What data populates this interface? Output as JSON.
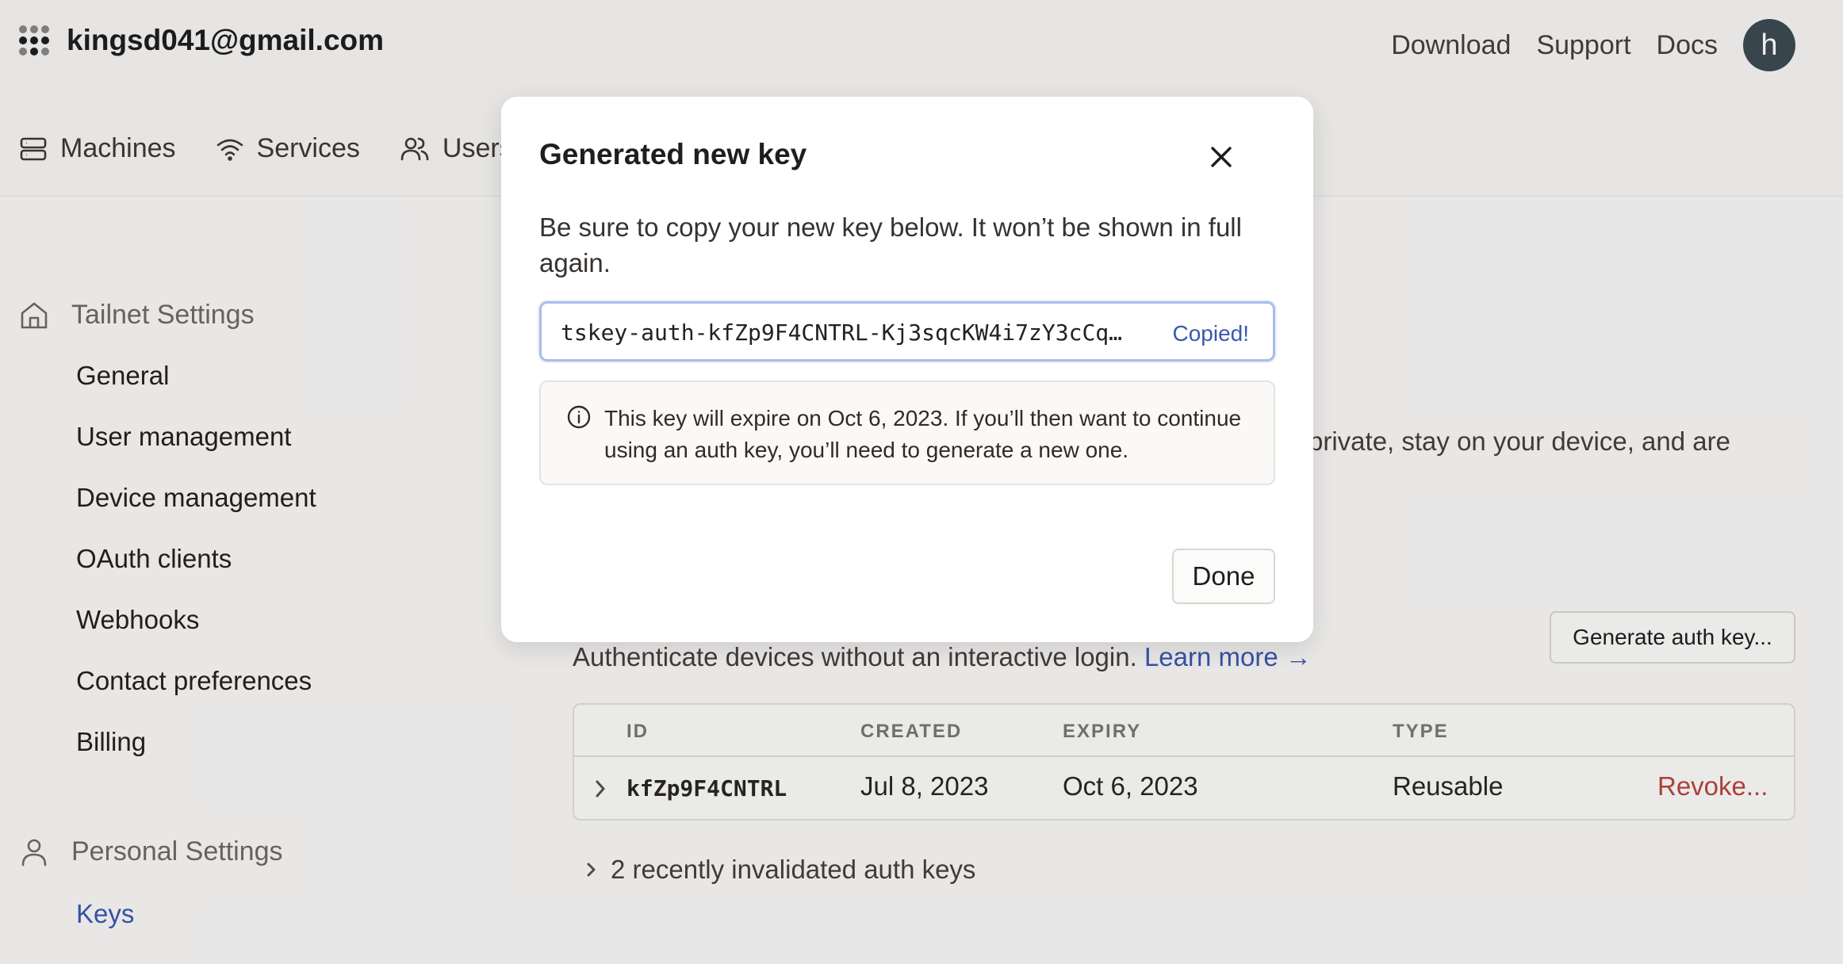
{
  "header": {
    "account": "kingsd041@gmail.com",
    "links": [
      "Download",
      "Support",
      "Docs"
    ],
    "avatar_initial": "h"
  },
  "tabs": [
    {
      "label": "Machines",
      "icon": "server-icon"
    },
    {
      "label": "Services",
      "icon": "wifi-icon"
    },
    {
      "label": "Users",
      "icon": "users-icon"
    }
  ],
  "sidebar": {
    "tailnet_title": "Tailnet Settings",
    "tailnet_items": [
      "General",
      "User management",
      "Device management",
      "OAuth clients",
      "Webhooks",
      "Contact preferences",
      "Billing"
    ],
    "personal_title": "Personal Settings",
    "personal_items": [
      "Keys"
    ]
  },
  "main": {
    "partial_description": "private, stay on your device, and are",
    "generate_button": "Generate auth key...",
    "auth_description": "Authenticate devices without an interactive login.",
    "learn_more": "Learn more →",
    "table": {
      "headers": [
        "ID",
        "CREATED",
        "EXPIRY",
        "TYPE"
      ],
      "rows": [
        {
          "id": "kfZp9F4CNTRL",
          "created": "Jul 8, 2023",
          "expiry": "Oct 6, 2023",
          "type": "Reusable",
          "action": "Revoke..."
        }
      ]
    },
    "invalidated": "2 recently invalidated auth keys"
  },
  "modal": {
    "title": "Generated new key",
    "text": "Be sure to copy your new key below. It won’t be shown in full again.",
    "key": "tskey-auth-kfZp9F4CNTRL-Kj3sqcKW4i7zY3cCq…",
    "copied": "Copied!",
    "info": "This key will expire on Oct 6, 2023. If you’ll then want to continue using an auth key, you’ll need to generate a new one.",
    "done": "Done"
  },
  "colors": {
    "accent": "#3a57b0",
    "danger": "#b8453c",
    "avatar": "#3e4a52"
  }
}
